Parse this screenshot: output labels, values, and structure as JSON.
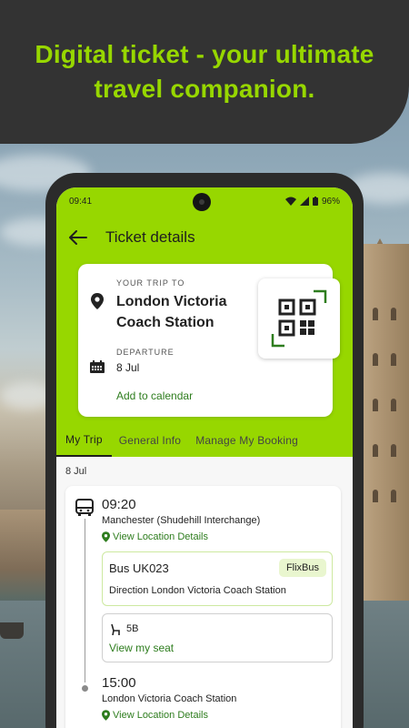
{
  "banner": {
    "line1": "Digital ticket - your ultimate",
    "line2": "travel companion."
  },
  "status_bar": {
    "time": "09:41",
    "battery": "96%"
  },
  "app_bar": {
    "title": "Ticket details"
  },
  "trip_card": {
    "trip_label": "YOUR TRIP TO",
    "destination_line1": "London Victoria",
    "destination_line2": "Coach Station",
    "departure_label": "DEPARTURE",
    "departure_date": "8 Jul",
    "add_calendar": "Add to calendar"
  },
  "tabs": [
    {
      "label": "My Trip",
      "active": true
    },
    {
      "label": "General Info",
      "active": false
    },
    {
      "label": "Manage My Booking",
      "active": false
    }
  ],
  "journey": {
    "date": "8 Jul",
    "departure_time": "09:20",
    "departure_stop": "Manchester (Shudehill Interchange)",
    "location_link": "View Location Details",
    "bus_number": "Bus UK023",
    "operator": "FlixBus",
    "direction": "Direction London Victoria Coach Station",
    "seat": "5B",
    "view_seat": "View my seat",
    "arrival_time": "15:00",
    "arrival_stop": "London Victoria Coach Station",
    "arrival_location_link": "View Location Details"
  },
  "colors": {
    "brand_green": "#97d700",
    "link_green": "#2e7d1e",
    "banner_dark": "#333333"
  },
  "icons": [
    "back-arrow-icon",
    "location-pin-icon",
    "calendar-icon",
    "qr-code-icon",
    "bus-icon",
    "seat-icon",
    "wifi-icon",
    "signal-icon",
    "battery-icon"
  ]
}
